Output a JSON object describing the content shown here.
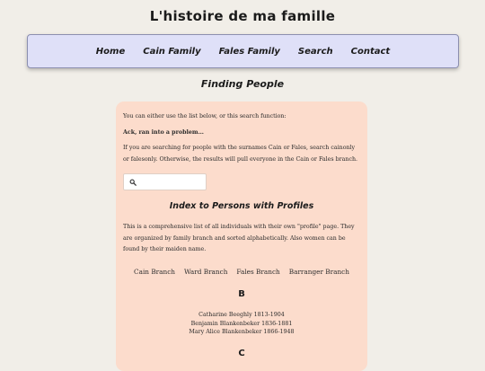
{
  "site": {
    "title": "L'histoire de ma famille"
  },
  "nav": {
    "items": [
      "Home",
      "Cain Family",
      "Fales Family",
      "Search",
      "Contact"
    ]
  },
  "page": {
    "heading": "Finding People"
  },
  "intro": {
    "line1": "You can either use the list below, or this search function:",
    "error": "Ack, ran into a problem…",
    "instructions": "If you are searching for people with the surnames Cain or Fales, search cainonly or falesonly. Otherwise, the results will pull everyone in the Cain or Fales branch."
  },
  "search": {
    "value": "",
    "icon": "search-icon"
  },
  "index": {
    "heading": "Index to Persons with Profiles",
    "description": "This is a comprehensive list of all individuals with their own \"profile\" page. They are organized by family branch and sorted alphabetically. Also women can be found by their maiden name."
  },
  "branches": [
    "Cain Branch",
    "Ward Branch",
    "Fales Branch",
    "Barranger Branch"
  ],
  "letters": [
    {
      "letter": "B",
      "people": [
        "Catharine Beeghly 1813-1904",
        "Benjamin Blankenbeker 1836-1881",
        "Mary Alice Blankenbeker 1866-1948"
      ]
    },
    {
      "letter": "C",
      "people": []
    }
  ]
}
